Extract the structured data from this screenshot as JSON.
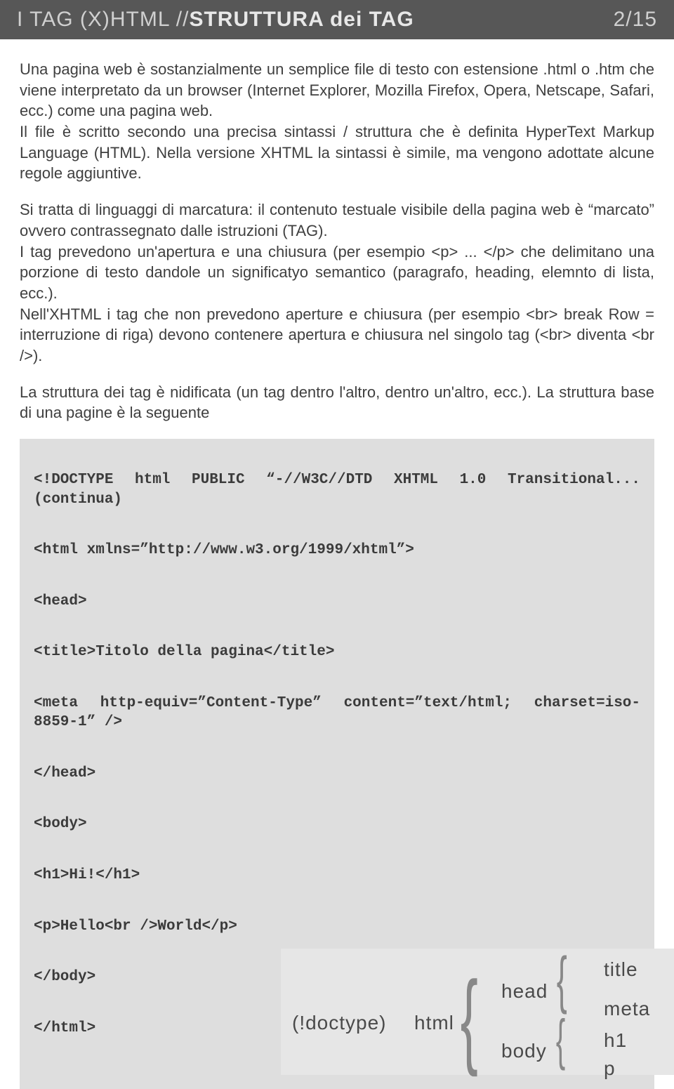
{
  "header": {
    "prefix": "I TAG (X)HTML // ",
    "title_bold": "STRUTTURA dei TAG",
    "page_number": "2/15"
  },
  "paragraphs": {
    "p1": "Una pagina web è sostanzialmente un semplice file di testo con estensione .html o .htm che viene interpretato da un browser (Internet Explorer, Mozilla Firefox, Opera, Netscape, Safari, ecc.) come una pagina web.",
    "p2": "Il file è scritto secondo una precisa sintassi / struttura che è definita HyperText Markup Language (HTML). Nella versione XHTML la sintassi è simile, ma vengono adottate alcune regole aggiuntive.",
    "p3": "Si tratta di linguaggi di marcatura: il contenuto testuale visibile della pagina web è “marcato” ovvero contrassegnato dalle istruzioni (TAG).",
    "p4": "I tag prevedono un'apertura e una chiusura (per esempio <p> ... </p> che delimitano una porzione di testo dandole un significatyo semantico (paragrafo, heading, elemnto di lista, ecc.).",
    "p5": "Nell'XHTML i tag che non prevedono aperture e chiusura (per esempio <br> break Row = interruzione di riga) devono contenere apertura e chiusura nel singolo tag (<br> diventa <br />).",
    "p6": "La struttura dei tag è nidificata (un tag dentro l'altro, dentro un'altro, ecc.). La struttura base di una pagine è la seguente"
  },
  "code": {
    "l1": "<!DOCTYPE html PUBLIC “-//W3C//DTD XHTML 1.0 Transitional... (continua)",
    "l2": "<html xmlns=”http://www.w3.org/1999/xhtml”>",
    "l3": "<head>",
    "l4": "<title>Titolo della pagina</title>",
    "l5": "<meta http-equiv=”Content-Type” content=”text/html; charset=iso-8859-1” />",
    "l6": "</head>",
    "l7": "<body>",
    "l8": "<h1>Hi!</h1>",
    "l9": "<p>Hello<br />World</p>",
    "l10": "</body>",
    "l11": "</html>"
  },
  "diagram": {
    "doctype": "(!doctype)",
    "html": "html",
    "head": "head",
    "body": "body",
    "title": "title",
    "meta": "meta",
    "h1": "h1",
    "p": "p"
  }
}
